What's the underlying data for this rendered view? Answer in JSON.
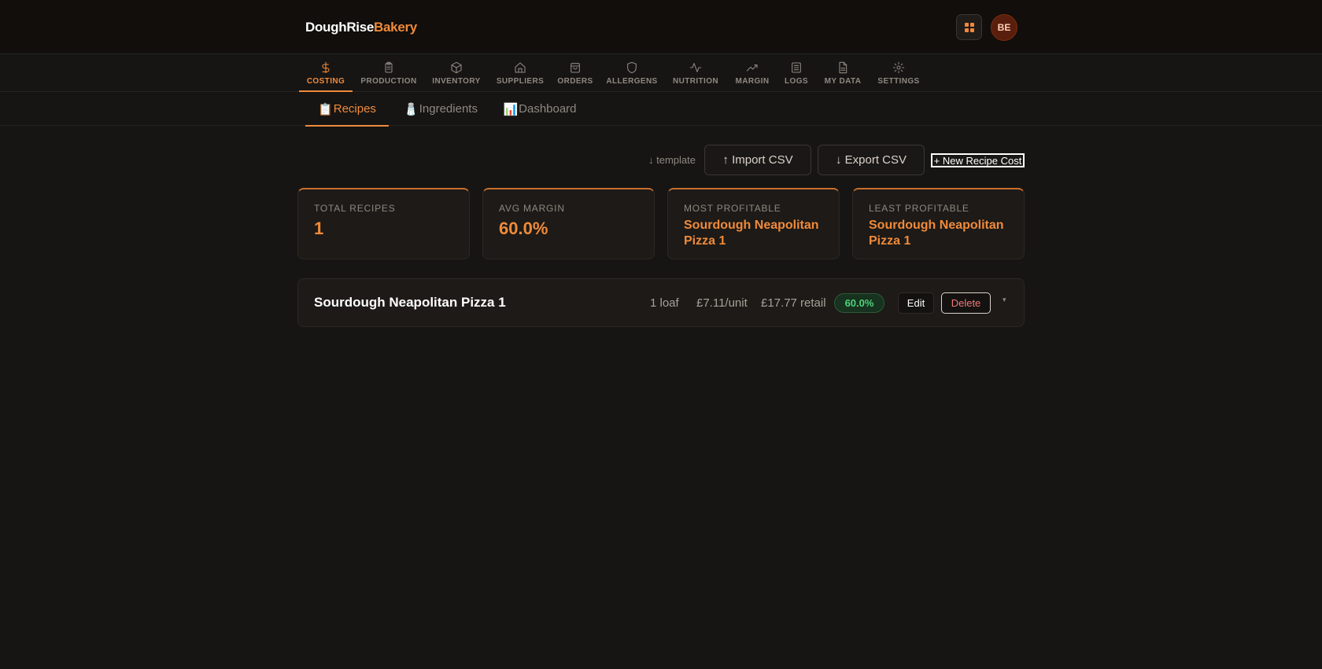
{
  "brand": {
    "name": "DoughRise",
    "accent": "Bakery"
  },
  "header": {
    "apps_icon": "grid-icon",
    "avatar_initials": "BE"
  },
  "main_nav": [
    {
      "label": "COSTING",
      "icon": "dollar-icon",
      "active": true
    },
    {
      "label": "PRODUCTION",
      "icon": "clipboard-icon"
    },
    {
      "label": "INVENTORY",
      "icon": "box-icon"
    },
    {
      "label": "SUPPLIERS",
      "icon": "home-icon"
    },
    {
      "label": "ORDERS",
      "icon": "bag-icon"
    },
    {
      "label": "ALLERGENS",
      "icon": "shield-icon"
    },
    {
      "label": "NUTRITION",
      "icon": "pulse-icon"
    },
    {
      "label": "MARGIN",
      "icon": "trend-icon"
    },
    {
      "label": "LOGS",
      "icon": "log-icon"
    },
    {
      "label": "MY DATA",
      "icon": "document-icon"
    },
    {
      "label": "SETTINGS",
      "icon": "gear-icon"
    }
  ],
  "sub_nav": [
    {
      "emoji": "📋",
      "label": "Recipes",
      "active": true
    },
    {
      "emoji": "🧂",
      "label": "Ingredients"
    },
    {
      "emoji": "📊",
      "label": "Dashboard"
    }
  ],
  "toolbar": {
    "template_link": "↓ template",
    "import_label": "↑ Import CSV",
    "export_label": "↓ Export CSV",
    "new_label": "+ New Recipe Cost"
  },
  "stats": [
    {
      "label": "TOTAL RECIPES",
      "value": "1"
    },
    {
      "label": "AVG MARGIN",
      "value": "60.0%"
    },
    {
      "label": "MOST PROFITABLE",
      "value": "Sourdough Neapolitan Pizza 1"
    },
    {
      "label": "LEAST PROFITABLE",
      "value": "Sourdough Neapolitan Pizza 1"
    }
  ],
  "recipes": [
    {
      "name": "Sourdough Neapolitan Pizza 1",
      "yield": "1 loaf",
      "unit_cost": "£7.11/unit",
      "retail": "£17.77 retail",
      "margin": "60.0%",
      "edit_label": "Edit",
      "delete_label": "Delete",
      "expand_glyph": "▾"
    }
  ],
  "colors": {
    "accent": "#f08a3a",
    "background": "#161514",
    "success": "#4ed27a",
    "danger": "#f0787a"
  }
}
